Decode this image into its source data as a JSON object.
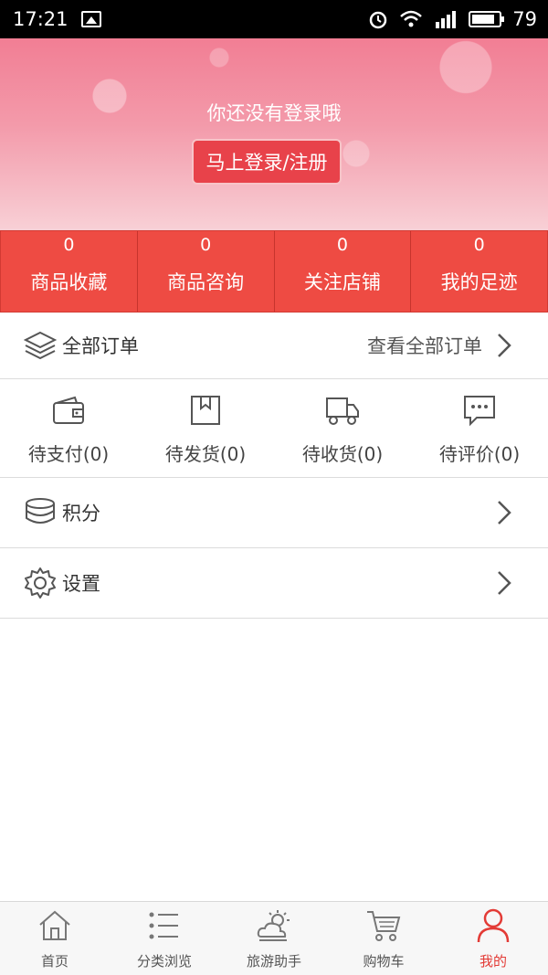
{
  "status_bar": {
    "time": "17:21",
    "battery": "79"
  },
  "hero": {
    "message": "你还没有登录哦",
    "login_label": "马上登录/注册"
  },
  "stats": [
    {
      "count": "0",
      "label": "商品收藏"
    },
    {
      "count": "0",
      "label": "商品咨询"
    },
    {
      "count": "0",
      "label": "关注店铺"
    },
    {
      "count": "0",
      "label": "我的足迹"
    }
  ],
  "orders_header": {
    "title": "全部订单",
    "view_all": "查看全部订单"
  },
  "orders": [
    {
      "label": "待支付(0)",
      "icon": "wallet-icon"
    },
    {
      "label": "待发货(0)",
      "icon": "package-icon"
    },
    {
      "label": "待收货(0)",
      "icon": "truck-icon"
    },
    {
      "label": "待评价(0)",
      "icon": "comment-icon"
    }
  ],
  "menu": {
    "points": "积分",
    "settings": "设置"
  },
  "tabbar": [
    {
      "label": "首页",
      "icon": "home-icon"
    },
    {
      "label": "分类浏览",
      "icon": "list-icon"
    },
    {
      "label": "旅游助手",
      "icon": "weather-icon"
    },
    {
      "label": "购物车",
      "icon": "cart-icon"
    },
    {
      "label": "我的",
      "icon": "user-icon",
      "active": true
    }
  ],
  "colors": {
    "accent": "#e33b36",
    "stats_bg": "#ee4b43"
  }
}
